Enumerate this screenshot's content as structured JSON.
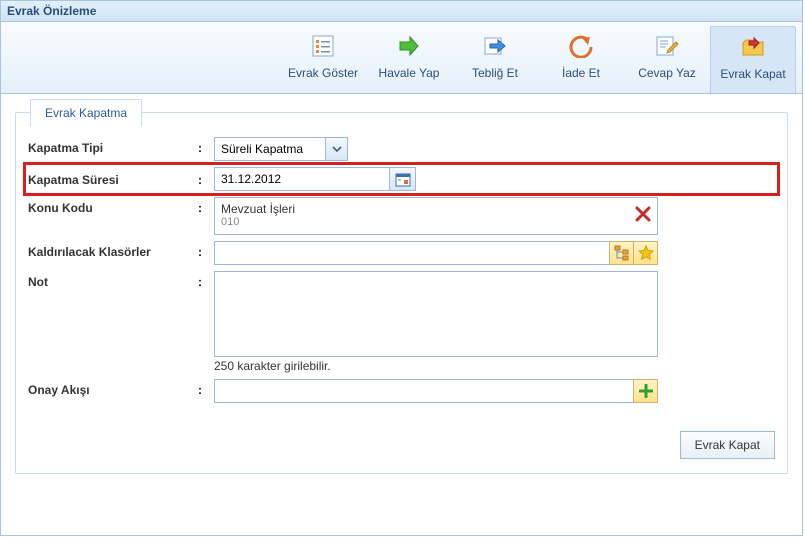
{
  "window": {
    "title": "Evrak Önizleme"
  },
  "toolbar": {
    "show": {
      "label": "Evrak Göster"
    },
    "havale": {
      "label": "Havale Yap"
    },
    "teblig": {
      "label": "Tebliğ Et"
    },
    "iade": {
      "label": "İade Et"
    },
    "cevap": {
      "label": "Cevap Yaz"
    },
    "kapat": {
      "label": "Evrak Kapat"
    }
  },
  "panel": {
    "title": "Evrak Kapatma",
    "kapatmaTipi": {
      "label": "Kapatma Tipi",
      "value": "Süreli Kapatma"
    },
    "kapatmaSuresi": {
      "label": "Kapatma Süresi",
      "value": "31.12.2012"
    },
    "konuKodu": {
      "label": "Konu Kodu",
      "item": {
        "title": "Mevzuat İşleri",
        "code": "010"
      }
    },
    "klasorler": {
      "label": "Kaldırılacak Klasörler",
      "value": ""
    },
    "not": {
      "label": "Not",
      "value": "",
      "hint": "250 karakter girilebilir."
    },
    "onayAkisi": {
      "label": "Onay Akışı",
      "value": ""
    }
  },
  "footer": {
    "submit": "Evrak Kapat"
  }
}
